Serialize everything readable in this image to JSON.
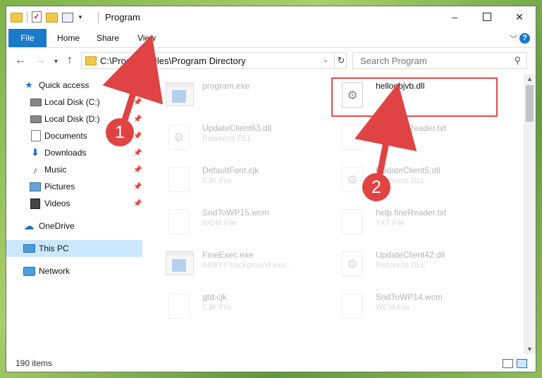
{
  "window": {
    "title": "Program",
    "controls": [
      "–",
      "☐",
      "✕"
    ]
  },
  "ribbon": {
    "tabs": [
      "File",
      "Home",
      "Share",
      "View"
    ],
    "help": "?"
  },
  "address": {
    "path": "C:\\Program Files\\Program Directory"
  },
  "search": {
    "placeholder": "Search Program"
  },
  "nav_pane": {
    "items": [
      {
        "label": "Quick access",
        "icon": "star-icon",
        "pinned": false
      },
      {
        "label": "Local Disk (C:)",
        "icon": "drive-icon",
        "pinned": true
      },
      {
        "label": "Local Disk (D:)",
        "icon": "drive-icon",
        "pinned": true
      },
      {
        "label": "Documents",
        "icon": "documents-icon",
        "pinned": true
      },
      {
        "label": "Downloads",
        "icon": "download-icon",
        "pinned": true
      },
      {
        "label": "Music",
        "icon": "music-icon",
        "pinned": true
      },
      {
        "label": "Pictures",
        "icon": "pictures-icon",
        "pinned": true
      },
      {
        "label": "Videos",
        "icon": "videos-icon",
        "pinned": true
      },
      {
        "label": "OneDrive",
        "icon": "onedrive-icon",
        "pinned": false
      },
      {
        "label": "This PC",
        "icon": "this-pc-icon",
        "pinned": false,
        "selected": true
      },
      {
        "label": "Network",
        "icon": "network-icon",
        "pinned": false
      }
    ]
  },
  "files": [
    {
      "name": "program.exe",
      "type": "",
      "icon": "exe-icon",
      "dim": true
    },
    {
      "name": "helloobjvb.dll",
      "type": "",
      "icon": "dll-gear-icon",
      "dim": false,
      "highlighted": true
    },
    {
      "name": "UpdateClient63.dll",
      "type": "Resource DLL",
      "icon": "dll-gear-icon",
      "dim": true
    },
    {
      "name": "help.fineReader.txt",
      "type": "TXT File",
      "icon": "text-file-icon",
      "dim": true
    },
    {
      "name": "DefaultFont.cjk",
      "type": "CJK File",
      "icon": "file-icon",
      "dim": true
    },
    {
      "name": "UpdateClient5.dll",
      "type": "Resource DLL",
      "icon": "dll-gear-icon",
      "dim": true
    },
    {
      "name": "SndToWP15.wcm",
      "type": "WCM File",
      "icon": "file-icon",
      "dim": true
    },
    {
      "name": "help.fineReader.txt",
      "type": "TXT File",
      "icon": "text-file-icon",
      "dim": true
    },
    {
      "name": "FineExec.exe",
      "type": "ABBYY background exe...",
      "icon": "exe-icon",
      "dim": true
    },
    {
      "name": "UpdateClient42.dll",
      "type": "Resource DLL",
      "icon": "dll-gear-icon",
      "dim": true
    },
    {
      "name": "gtd.cjk",
      "type": "CJK File",
      "icon": "file-icon",
      "dim": true
    },
    {
      "name": "SndToWP14.wcm",
      "type": "WCM File",
      "icon": "file-icon",
      "dim": true
    }
  ],
  "status": {
    "item_count": "190 items"
  },
  "callouts": {
    "step1": "1",
    "step2": "2",
    "color": "#e04343"
  }
}
